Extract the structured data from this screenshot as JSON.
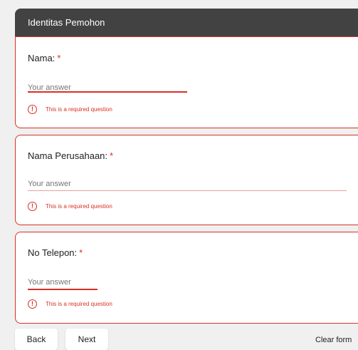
{
  "section": {
    "title": "Identitas Pemohon"
  },
  "questions": [
    {
      "label": "Nama:",
      "required_mark": "*",
      "placeholder": "Your answer",
      "error": "This is a required question"
    },
    {
      "label": "Nama Perusahaan:",
      "required_mark": "*",
      "placeholder": "Your answer",
      "error": "This is a required question"
    },
    {
      "label": "No Telepon:",
      "required_mark": "*",
      "placeholder": "Your answer",
      "error": "This is a required question"
    }
  ],
  "icons": {
    "error": "error-circle-icon"
  },
  "footer": {
    "back_label": "Back",
    "next_label": "Next",
    "clear_label": "Clear form"
  },
  "colors": {
    "accent": "#d93025",
    "header": "#424242",
    "background": "#f0f0f0"
  }
}
